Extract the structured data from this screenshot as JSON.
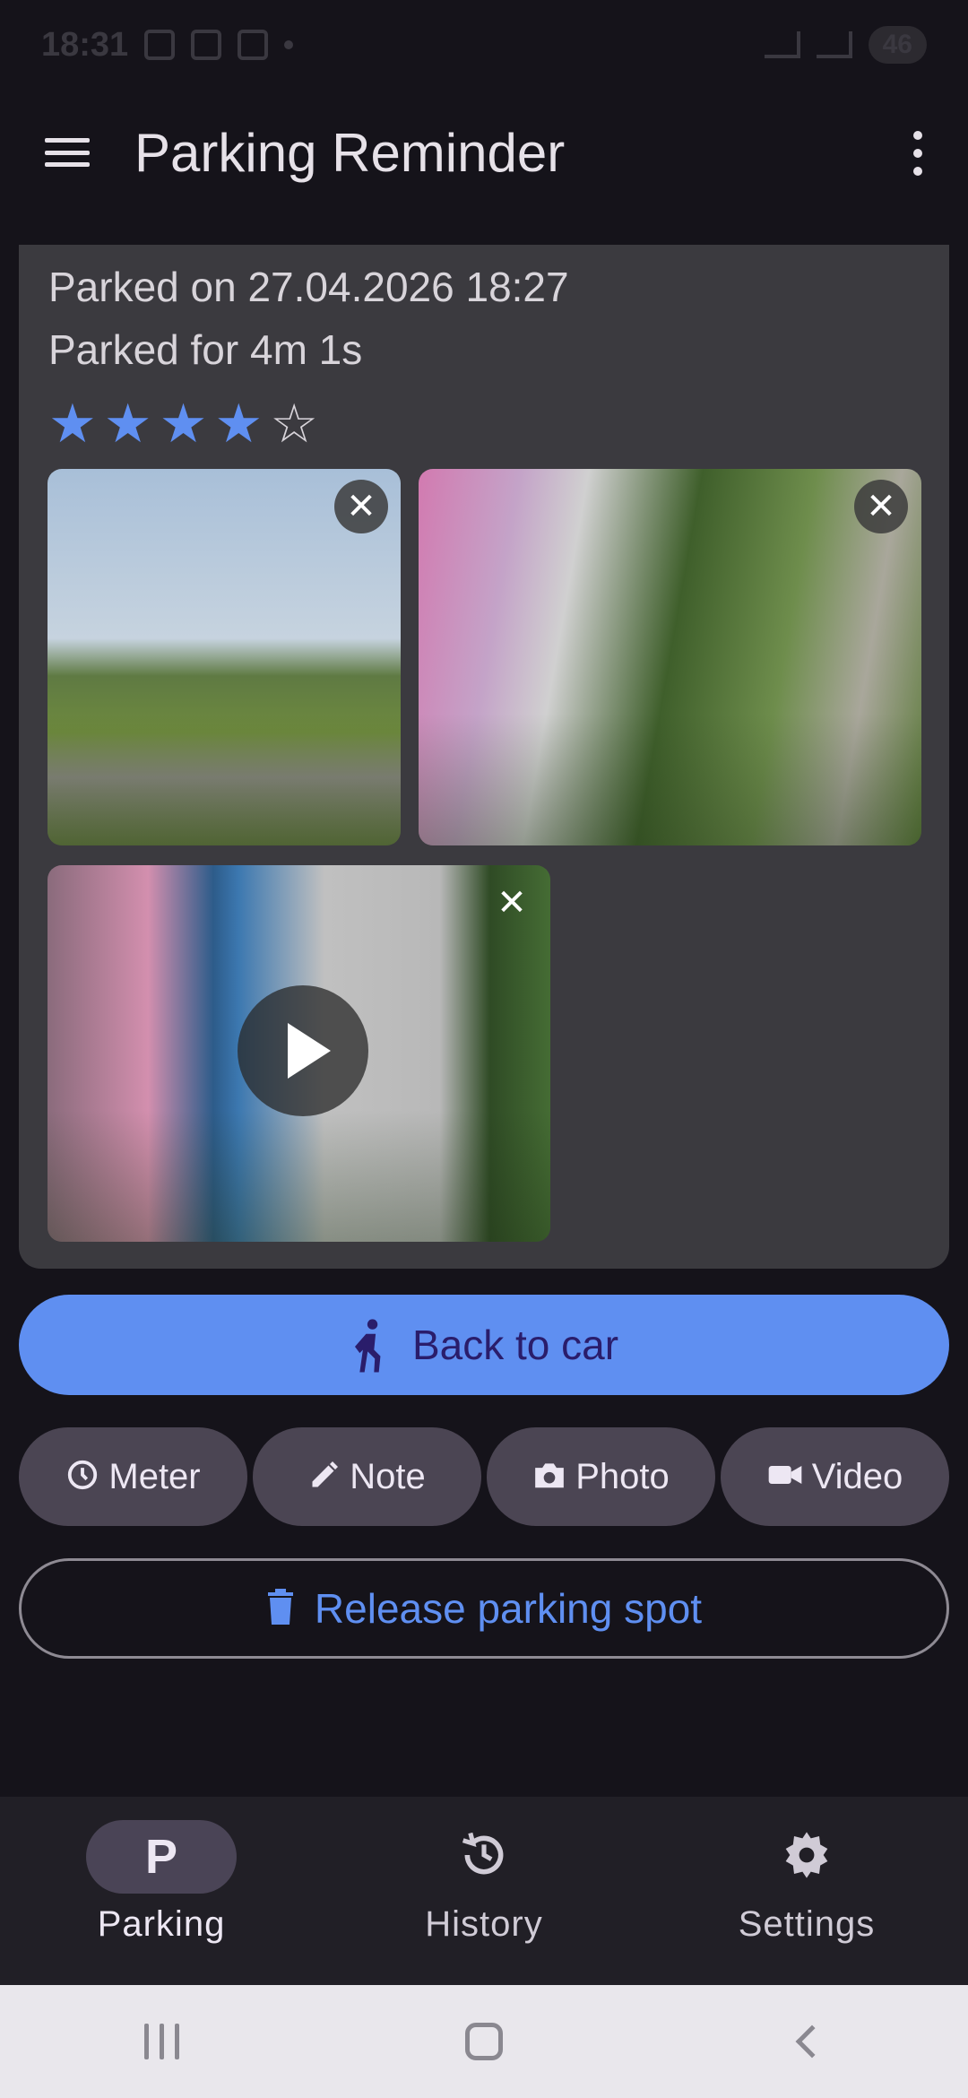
{
  "status_bar": {
    "time": "18:31",
    "battery": "46"
  },
  "app_bar": {
    "title": "Parking Reminder"
  },
  "parking_card": {
    "parked_on": "Parked on 27.04.2026 18:27",
    "parked_for": "Parked for 4m 1s",
    "rating": 4,
    "rating_max": 5,
    "media": [
      {
        "type": "photo",
        "description": "park-field"
      },
      {
        "type": "photo",
        "description": "graffiti-wall"
      },
      {
        "type": "video",
        "description": "graffiti-wall-video"
      }
    ]
  },
  "actions": {
    "back_to_car": "Back to car",
    "meter": "Meter",
    "note": "Note",
    "photo": "Photo",
    "video": "Video",
    "release": "Release parking spot"
  },
  "bottom_nav": {
    "parking_icon_letter": "P",
    "parking": "Parking",
    "history": "History",
    "settings": "Settings"
  },
  "colors": {
    "accent": "#5f8ff1",
    "background": "#15131a",
    "card": "#3b3a3f",
    "chip": "#4b4553"
  }
}
